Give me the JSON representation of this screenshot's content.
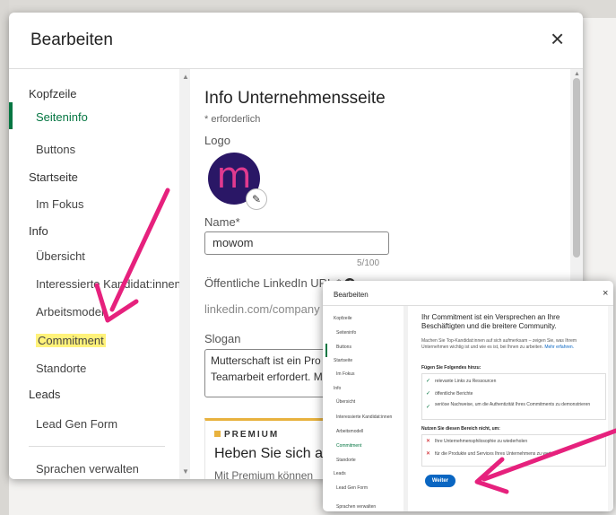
{
  "main_modal": {
    "title": "Bearbeiten",
    "close": "×",
    "sidebar": {
      "sections": [
        {
          "header": "Kopfzeile",
          "items": [
            "Seiteninfo",
            "Buttons"
          ]
        },
        {
          "header": "Startseite",
          "items": [
            "Im Fokus"
          ]
        },
        {
          "header": "Info",
          "items": [
            "Übersicht",
            "Interessierte Kandidat:innen",
            "Arbeitsmodell",
            "Commitment",
            "Standorte"
          ]
        },
        {
          "header": "Leads",
          "items": [
            "Lead Gen Form"
          ]
        }
      ],
      "footer": "Sprachen verwalten",
      "active_item": "Seiteninfo",
      "highlighted_item": "Commitment"
    },
    "content": {
      "heading": "Info Unternehmensseite",
      "required_note": "* erforderlich",
      "logo_label": "Logo",
      "logo_letter": "m",
      "name_label": "Name*",
      "name_value": "mowom",
      "name_counter": "5/100",
      "url_label": "Öffentliche LinkedIn URL *",
      "url_prefix": "linkedin.com/company",
      "slogan_label": "Slogan",
      "slogan_line1": "Mutterschaft ist ein Pro",
      "slogan_line2": "Teamarbeit erfordert. M",
      "premium_tag": "PREMIUM",
      "premium_heading": "Heben Sie sich ab",
      "premium_text": "Mit Premium können"
    }
  },
  "inset_modal": {
    "title": "Bearbeiten",
    "close": "×",
    "sidebar": [
      "Kopfzeile",
      "Seiteninfo",
      "Buttons",
      "Startseite",
      "Im Fokus",
      "Info",
      "Übersicht",
      "Interessierte Kandidat:innen",
      "Arbeitsmodell",
      "Commitment",
      "Standorte",
      "Leads",
      "Lead Gen Form",
      "Sprachen verwalten"
    ],
    "heading": "Ihr Commitment ist ein Versprechen an Ihre Beschäftigten und die breitere Community.",
    "intro": "Machen Sie Top-Kandidat:innen auf sich aufmerksam – zeigen Sie, was Ihrem Unternehmen wichtig ist und wie es ist, bei Ihnen zu arbeiten.",
    "intro_link": "Mehr erfahren.",
    "do_heading": "Fügen Sie Folgendes hinzu:",
    "do_items": [
      "relevante Links zu Ressourcen",
      "öffentliche Berichte",
      "seriöse Nachweise, um die Authentizität Ihres Commitments zu demonstrieren"
    ],
    "dont_heading": "Nutzen Sie diesen Bereich nicht, um:",
    "dont_items": [
      "Ihre Unternehmensphilosophie zu wiederholen",
      "für die Produkte und Services Ihres Unternehmens zu werben"
    ],
    "button": "Weiter"
  },
  "colors": {
    "accent_green": "#057642",
    "highlight": "#fff27a",
    "arrow": "#e6217d",
    "button_blue": "#0a66c2",
    "logo_bg": "#2a1766",
    "logo_letter": "#e13a8f"
  }
}
